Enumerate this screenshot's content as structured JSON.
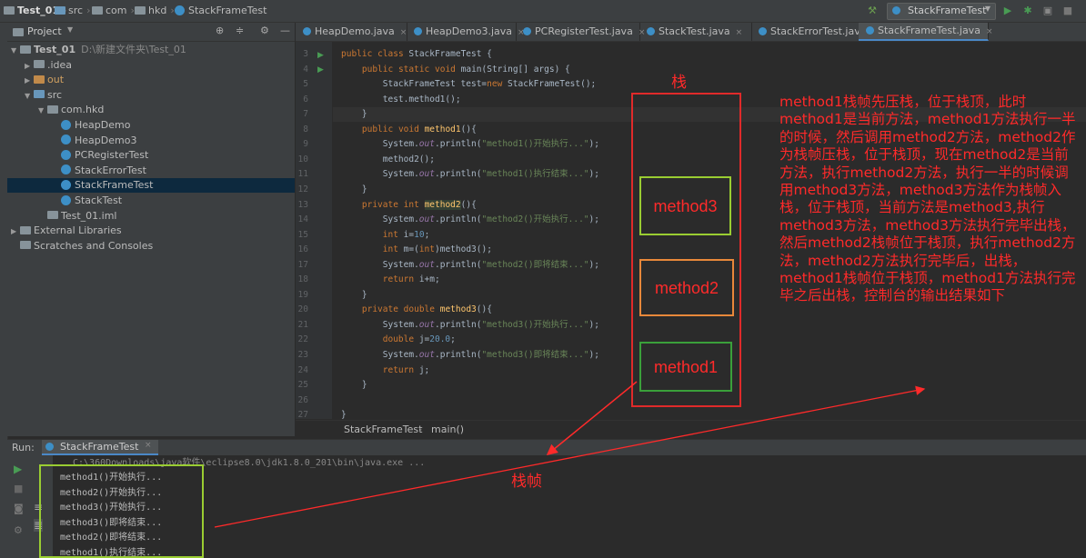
{
  "navbar": {
    "crumbs": [
      "Test_01",
      "src",
      "com",
      "hkd",
      "StackFrameTest"
    ],
    "run_config": "StackFrameTest"
  },
  "project_panel": {
    "title": "Project",
    "tree": [
      {
        "label": "Test_01",
        "extra": "D:\\新建文件夹\\Test_01",
        "indent": 0,
        "kind": "module",
        "expanded": true
      },
      {
        "label": ".idea",
        "indent": 1,
        "kind": "folder",
        "expanded": false
      },
      {
        "label": "out",
        "indent": 1,
        "kind": "folder-orange",
        "expanded": false
      },
      {
        "label": "src",
        "indent": 1,
        "kind": "folder-blue",
        "expanded": true
      },
      {
        "label": "com.hkd",
        "indent": 2,
        "kind": "package",
        "expanded": true
      },
      {
        "label": "HeapDemo",
        "indent": 3,
        "kind": "class"
      },
      {
        "label": "HeapDemo3",
        "indent": 3,
        "kind": "class"
      },
      {
        "label": "PCRegisterTest",
        "indent": 3,
        "kind": "class"
      },
      {
        "label": "StackErrorTest",
        "indent": 3,
        "kind": "class"
      },
      {
        "label": "StackFrameTest",
        "indent": 3,
        "kind": "class",
        "selected": true
      },
      {
        "label": "StackTest",
        "indent": 3,
        "kind": "class"
      },
      {
        "label": "Test_01.iml",
        "indent": 2,
        "kind": "file"
      },
      {
        "label": "External Libraries",
        "indent": 0,
        "kind": "lib",
        "expanded": false
      },
      {
        "label": "Scratches and Consoles",
        "indent": 0,
        "kind": "scratch"
      }
    ]
  },
  "tabs": [
    "HeapDemo.java",
    "HeapDemo3.java",
    "PCRegisterTest.java",
    "StackTest.java",
    "StackErrorTest.java",
    "StackFrameTest.java"
  ],
  "active_tab": "StackFrameTest.java",
  "line_numbers": [
    "3",
    "4",
    "5",
    "6",
    "7",
    "8",
    "9",
    "10",
    "11",
    "12",
    "13",
    "14",
    "15",
    "16",
    "17",
    "18",
    "19",
    "20",
    "21",
    "22",
    "23",
    "24",
    "25",
    "26",
    "27"
  ],
  "code_lines": [
    "public class StackFrameTest {",
    "    public static void main(String[] args) {",
    "        StackFrameTest test=new StackFrameTest();",
    "        test.method1();",
    "    }",
    "    public void method1(){",
    "        System.out.println(\"method1()开始执行...\");",
    "        method2();",
    "        System.out.println(\"method1()执行结束...\");",
    "    }",
    "    private int method2(){",
    "        System.out.println(\"method2()开始执行...\");",
    "        int i=10;",
    "        int m=(int)method3();",
    "        System.out.println(\"method2()即将结束...\");",
    "        return i+m;",
    "    }",
    "    private double method3(){",
    "        System.out.println(\"method3()开始执行...\");",
    "        double j=20.0;",
    "        System.out.println(\"method3()即将结束...\");",
    "        return j;",
    "    }",
    "",
    "}"
  ],
  "editor_breadcrumb": [
    "StackFrameTest",
    "main()"
  ],
  "run_panel": {
    "label": "Run:",
    "tab": "StackFrameTest",
    "command": "C:\\360Downloads\\java软件\\eclipse8.0\\jdk1.8.0_201\\bin\\java.exe ...",
    "output": [
      "method1()开始执行...",
      "method2()开始执行...",
      "method3()开始执行...",
      "method3()即将结束...",
      "method2()即将结束...",
      "method1()执行结束..."
    ]
  },
  "annotations": {
    "stack_label": "栈",
    "frame_label": "栈帧",
    "frames": [
      "method3",
      "method2",
      "method1"
    ],
    "frame_colors": [
      "#9acd32",
      "#e8883a",
      "#3aa03a"
    ],
    "explanation": "method1栈帧先压栈，位于栈顶，此时method1是当前方法，method1方法执行一半的时候，然后调用method2方法，method2作为栈帧压栈，位于栈顶，现在method2是当前方法，执行method2方法，执行一半的时候调用method3方法，method3方法作为栈帧入栈，位于栈顶，当前方法是method3,执行method3方法，method3方法执行完毕出栈，然后method2栈帧位于栈顶，执行method2方法，method2方法执行完毕后，出栈，method1栈帧位于栈顶，method1方法执行完毕之后出栈，控制台的输出结果如下"
  }
}
